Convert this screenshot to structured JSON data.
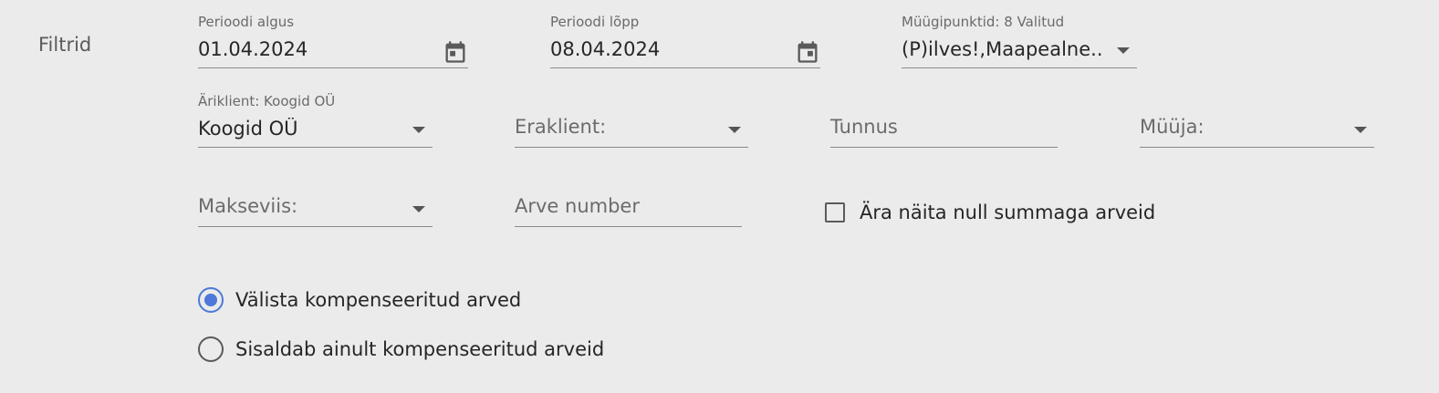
{
  "filters": {
    "section_label": "Filtrid",
    "period_start": {
      "label": "Perioodi algus",
      "value": "01.04.2024"
    },
    "period_end": {
      "label": "Perioodi lõpp",
      "value": "08.04.2024"
    },
    "sales_points": {
      "label": "Müügipunktid: 8 Valitud",
      "value": "(P)ilves!,Maapealne..."
    },
    "business_client": {
      "label": "Äriklient: Koogid OÜ",
      "value": "Koogid OÜ"
    },
    "private_client": {
      "placeholder": "Eraklient:"
    },
    "identifier": {
      "placeholder": "Tunnus"
    },
    "seller": {
      "placeholder": "Müüja:"
    },
    "payment_method": {
      "placeholder": "Makseviis:"
    },
    "invoice_number": {
      "placeholder": "Arve number"
    },
    "hide_zero_sum": {
      "label": "Ära näita null summaga arveid",
      "checked": false
    },
    "compensated": {
      "options": [
        {
          "label": "Välista kompenseeritud arved",
          "selected": true
        },
        {
          "label": "Sisaldab ainult kompenseeritud arveid",
          "selected": false
        }
      ]
    }
  },
  "colors": {
    "background": "#ebebeb",
    "accent": "#4e79d9",
    "underline": "#8b8b8b"
  }
}
